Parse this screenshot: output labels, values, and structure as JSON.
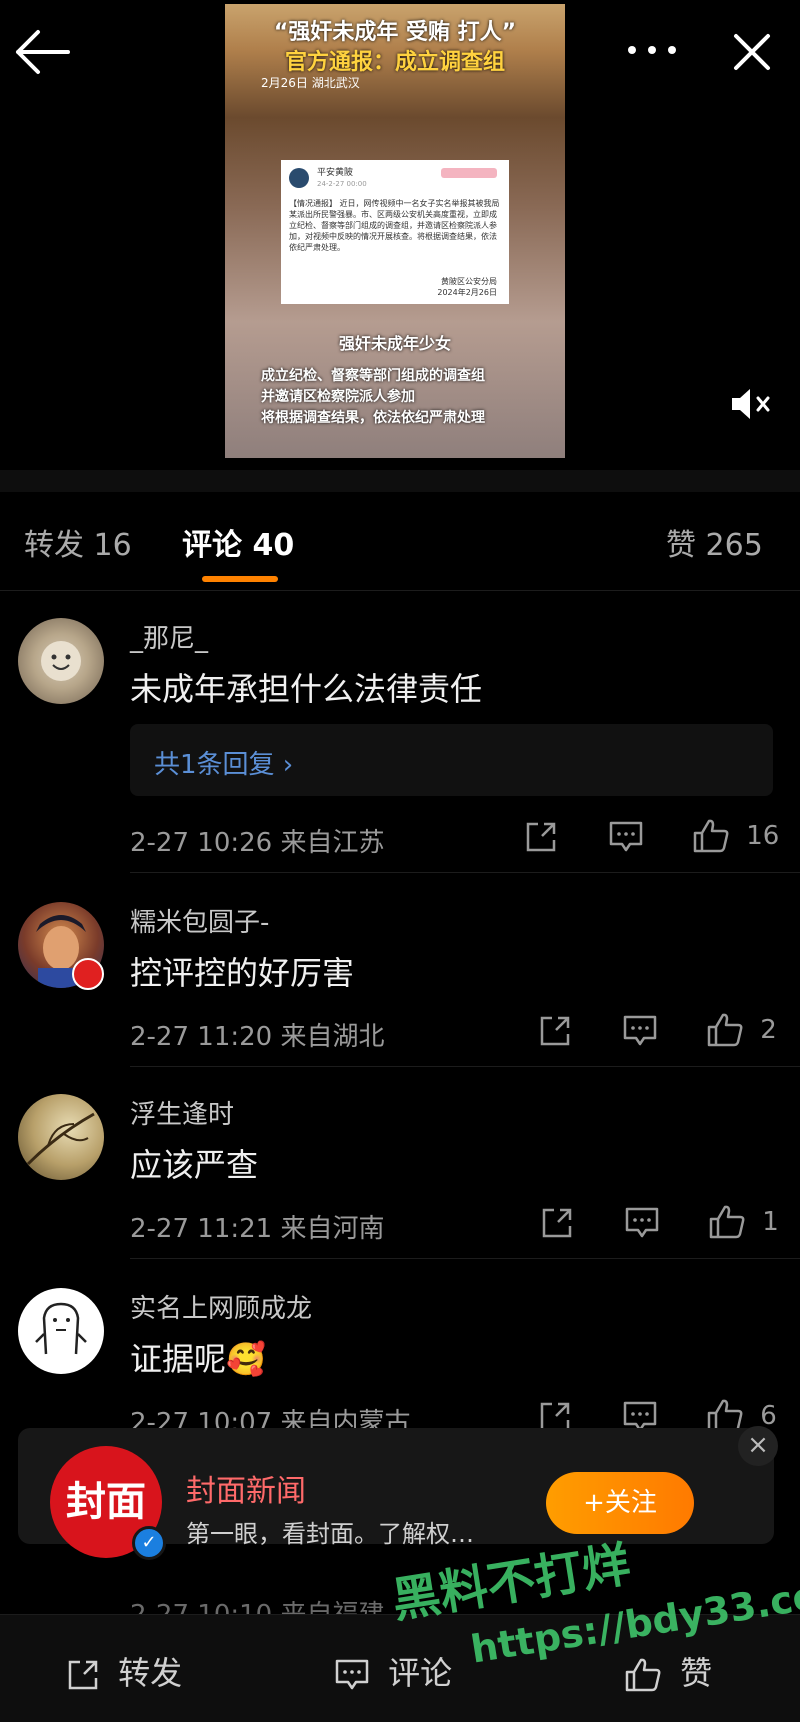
{
  "video": {
    "headline1": "“强奸未成年 受贿 打人”",
    "headline2": "官方通报：成立调查组",
    "date_loc": "2月26日 湖北武汉",
    "notice_account": "平安黄陂",
    "notice_time": "24-2-27 00:00",
    "notice_body": "【情况通报】 近日，网传视频中一名女子实名举报其被我局某派出所民警强暴。市、区两级公安机关高度重视，立即成立纪检、督察等部门组成的调查组，并邀请区检察院派人参加，对视频中反映的情况开展核查。将根据调查结果，依法依纪严肃处理。",
    "notice_org": "黄陂区公安分局",
    "notice_date": "2024年2月26日",
    "caption1": "强奸未成年少女",
    "caption2": "成立纪检、督察等部门组成的调查组",
    "caption3": "并邀请区检察院派人参加",
    "caption4": "将根据调查结果，依法依纪严肃处理"
  },
  "tabs": {
    "repost": "转发 16",
    "comments": "评论 40",
    "likes": "赞 265"
  },
  "comments": [
    {
      "user": "_那尼_",
      "text": "未成年承担什么法律责任",
      "reply_link": "共1条回复 ›",
      "time": "2-27 10:26 来自江苏",
      "likes": "16"
    },
    {
      "user": "糯米包圆子-",
      "text": "控评控的好厉害",
      "time": "2-27 11:20 来自湖北",
      "likes": "2"
    },
    {
      "user": "浮生逢时",
      "text": "应该严查",
      "time": "2-27 11:21 来自河南",
      "likes": "1"
    },
    {
      "user": "实名上网顾成龙",
      "text": "证据呢🥰",
      "time": "2-27 10:07 来自内蒙古",
      "likes": "6"
    },
    {
      "time": "2-27 10:10 来自福建"
    }
  ],
  "banner": {
    "logo": "封面",
    "name": "封面新闻",
    "desc": "第一眼，看封面。了解权…",
    "follow": "+关注"
  },
  "bottombar": {
    "repost": "转发",
    "comment": "评论",
    "like": "赞"
  },
  "watermark": {
    "line1": "黑料不打烊",
    "line2": "https://bdy33.co"
  }
}
